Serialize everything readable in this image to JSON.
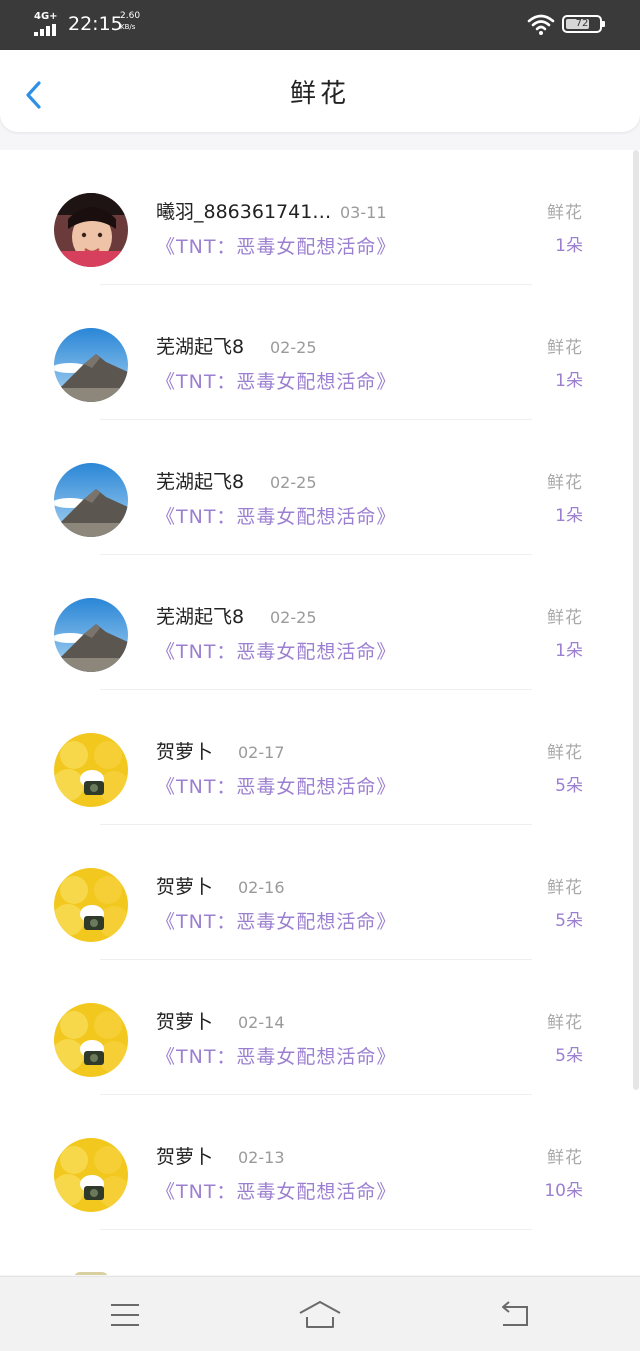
{
  "status_bar": {
    "network": "4G+",
    "time": "22:15",
    "speed_value": "2.60",
    "speed_unit": "KB/s",
    "battery": "72",
    "battery_level": 0.72
  },
  "header": {
    "title": "鲜花",
    "back_icon": "chevron-left-icon"
  },
  "colors": {
    "accent_blue": "#2d8fe6",
    "book_purple": "#9b7fd0",
    "muted_gray": "#aaaaaa"
  },
  "list": {
    "items": [
      {
        "user": "曦羽_886361741…",
        "date": "03-11",
        "book": "《TNT：恶毒女配想活命》",
        "gift": "鲜花",
        "count": "1朵",
        "avatar": "portrait"
      },
      {
        "user": "芜湖起飞8",
        "date": "02-25",
        "book": "《TNT：恶毒女配想活命》",
        "gift": "鲜花",
        "count": "1朵",
        "avatar": "mountain"
      },
      {
        "user": "芜湖起飞8",
        "date": "02-25",
        "book": "《TNT：恶毒女配想活命》",
        "gift": "鲜花",
        "count": "1朵",
        "avatar": "mountain"
      },
      {
        "user": "芜湖起飞8",
        "date": "02-25",
        "book": "《TNT：恶毒女配想活命》",
        "gift": "鲜花",
        "count": "1朵",
        "avatar": "mountain"
      },
      {
        "user": "贺萝卜",
        "date": "02-17",
        "book": "《TNT：恶毒女配想活命》",
        "gift": "鲜花",
        "count": "5朵",
        "avatar": "flower"
      },
      {
        "user": "贺萝卜",
        "date": "02-16",
        "book": "《TNT：恶毒女配想活命》",
        "gift": "鲜花",
        "count": "5朵",
        "avatar": "flower"
      },
      {
        "user": "贺萝卜",
        "date": "02-14",
        "book": "《TNT：恶毒女配想活命》",
        "gift": "鲜花",
        "count": "5朵",
        "avatar": "flower"
      },
      {
        "user": "贺萝卜",
        "date": "02-13",
        "book": "《TNT：恶毒女配想活命》",
        "gift": "鲜花",
        "count": "10朵",
        "avatar": "flower"
      }
    ]
  },
  "nav_bar": {
    "icons": [
      "menu-icon",
      "home-icon",
      "back-icon"
    ]
  }
}
